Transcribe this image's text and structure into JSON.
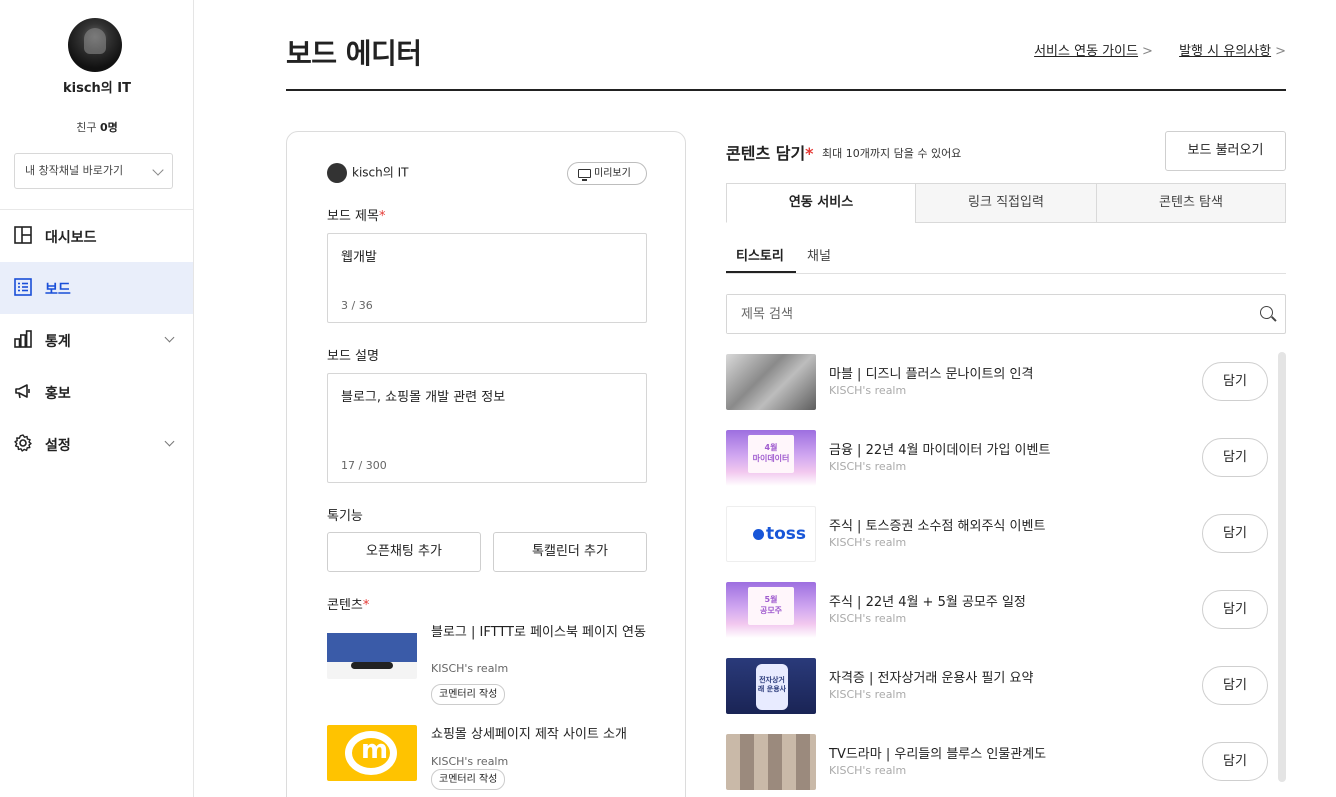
{
  "sidebar": {
    "nickname": "kisch의 IT",
    "friends_label": "친구",
    "friends_count": "0명",
    "channel_select": "내 창작채널 바로가기",
    "nav": [
      {
        "label": "대시보드",
        "icon": "dashboard-icon"
      },
      {
        "label": "보드",
        "icon": "board-list-icon",
        "active": true
      },
      {
        "label": "통계",
        "icon": "bar-chart-icon"
      },
      {
        "label": "홍보",
        "icon": "megaphone-icon"
      },
      {
        "label": "설정",
        "icon": "gear-icon"
      }
    ]
  },
  "header": {
    "title": "보드 에디터",
    "links": [
      "서비스 연동 가이드",
      "발행 시 유의사항"
    ],
    "link_arrow": ">"
  },
  "board": {
    "owner": "kisch의 IT",
    "preview_label": "미리보기",
    "title_label": "보드 제목",
    "title_value": "웹개발",
    "title_counter": "3 / 36",
    "desc_label": "보드 설명",
    "desc_value": "블로그, 쇼핑몰 개발 관련 정보",
    "desc_counter": "17 / 300",
    "features_label": "톡기능",
    "feature_buttons": [
      "오픈채팅 추가",
      "톡캘린더 추가"
    ],
    "contents_label": "콘텐츠",
    "required_mark": "*",
    "contents": [
      {
        "title": "블로그 | IFTTT로 페이스북 페이지 연동",
        "source": "KISCH's realm",
        "tag": "코멘터리 작성"
      },
      {
        "title": "쇼핑몰 상세페이지 제작 사이트 소개",
        "source": "KISCH's realm",
        "tag": "코멘터리 작성"
      }
    ]
  },
  "panel": {
    "title": "콘텐츠 담기",
    "required_mark": "*",
    "subtitle": "최대 10개까지 담을 수 있어요",
    "load_button": "보드 불러오기",
    "tabs": [
      "연동 서비스",
      "링크 직접입력",
      "콘텐츠 탐색"
    ],
    "subtabs": [
      "티스토리",
      "채널"
    ],
    "search_placeholder": "제목 검색",
    "add_label": "담기",
    "items": [
      {
        "title": "마블 | 디즈니 플러스 문나이트의 인격",
        "source": "KISCH's realm"
      },
      {
        "title": "금융 | 22년 4월 마이데이터 가입 이벤트",
        "source": "KISCH's realm"
      },
      {
        "title": "주식 | 토스증권 소수점 해외주식 이벤트",
        "source": "KISCH's realm"
      },
      {
        "title": "주식 | 22년 4월 + 5월 공모주 일정",
        "source": "KISCH's realm"
      },
      {
        "title": "자격증 | 전자상거래 운용사 필기 요약",
        "source": "KISCH's realm"
      },
      {
        "title": "TV드라마 | 우리들의 블루스 인물관계도",
        "source": "KISCH's realm"
      }
    ],
    "thumb_text": {
      "mydata_month": "4월",
      "mydata": "마이데이터",
      "toss": "toss",
      "ipo_month": "5월",
      "ipo": "공모주",
      "cert": "전자상거래 운용사"
    }
  },
  "colors": {
    "accent": "#1a4fd8",
    "active_bg": "#e9eefa",
    "required": "#e53935"
  }
}
